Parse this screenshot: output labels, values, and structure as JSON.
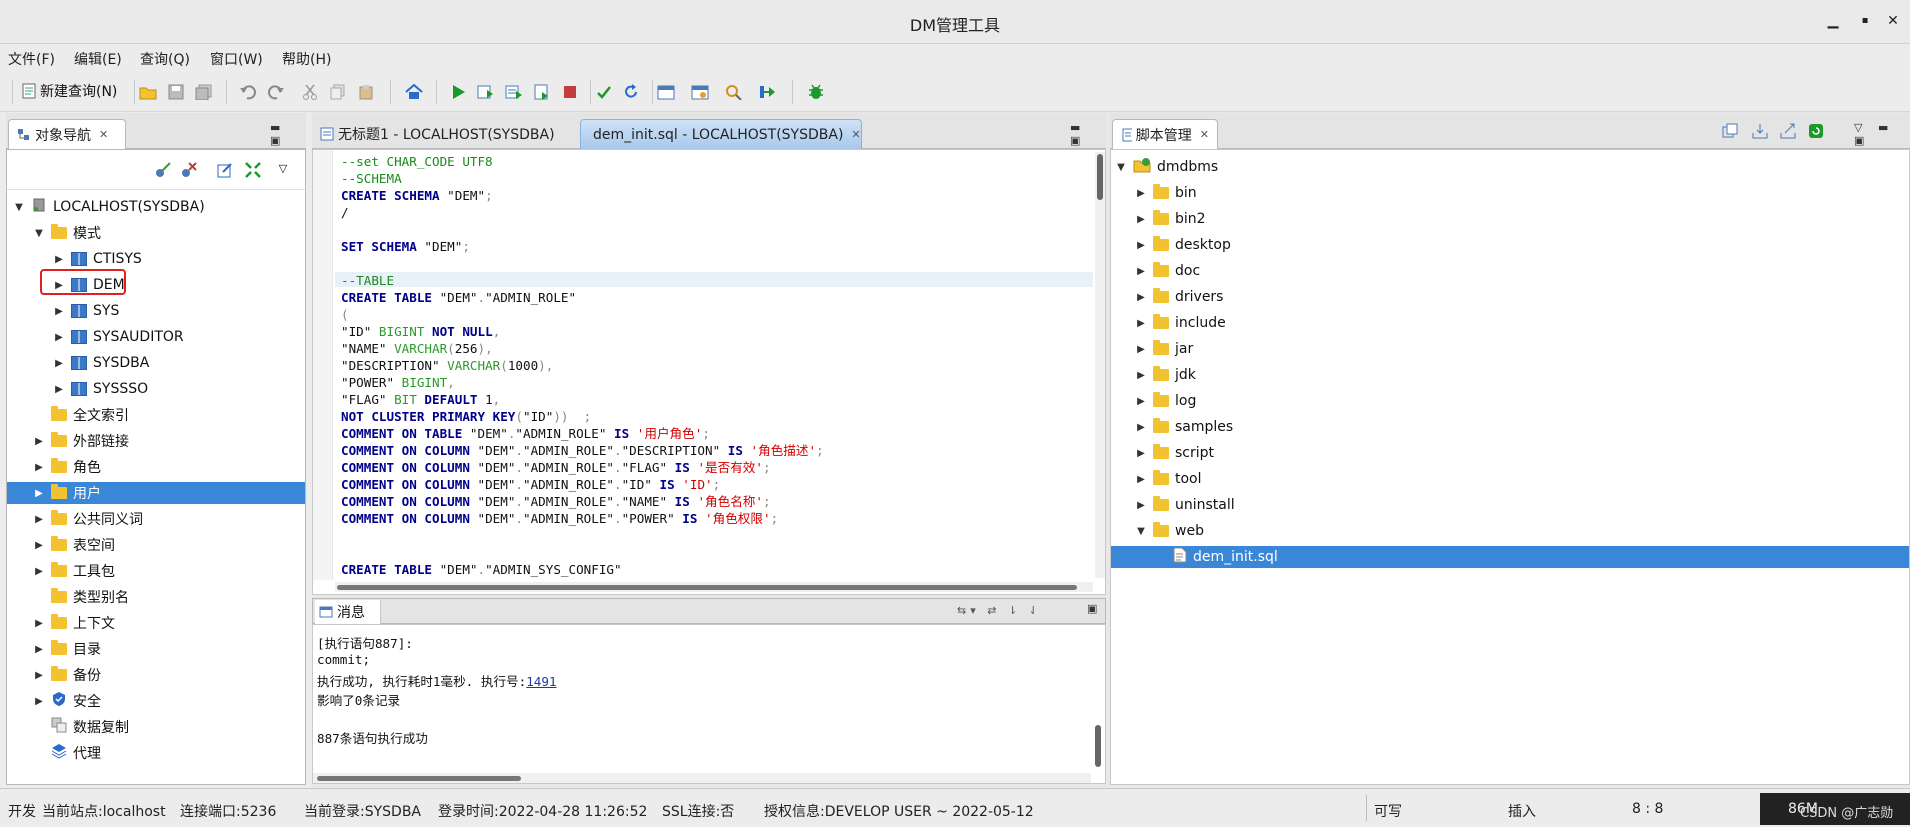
{
  "window": {
    "title": "DM管理工具",
    "minimize": "▪",
    "maximize": "▪",
    "close": "✕"
  },
  "menu": [
    "文件(F)",
    "编辑(E)",
    "查询(Q)",
    "窗口(W)",
    "帮助(H)"
  ],
  "toolbar": {
    "new_query_label": "新建查询(N)"
  },
  "nav": {
    "tab_label": "对象导航",
    "tree": [
      {
        "label": "LOCALHOST(SYSDBA)",
        "level": 0,
        "expanded": true,
        "icon": "server-icon"
      },
      {
        "label": "模式",
        "level": 1,
        "expanded": true,
        "icon": "folder-open-icon"
      },
      {
        "label": "CTISYS",
        "level": 2,
        "expanded": false,
        "icon": "schema-icon"
      },
      {
        "label": "DEM",
        "level": 2,
        "expanded": false,
        "icon": "schema-icon",
        "highlighted": true
      },
      {
        "label": "SYS",
        "level": 2,
        "expanded": false,
        "icon": "schema-icon"
      },
      {
        "label": "SYSAUDITOR",
        "level": 2,
        "expanded": false,
        "icon": "schema-icon"
      },
      {
        "label": "SYSDBA",
        "level": 2,
        "expanded": false,
        "icon": "schema-icon"
      },
      {
        "label": "SYSSSO",
        "level": 2,
        "expanded": false,
        "icon": "schema-icon"
      },
      {
        "label": "全文索引",
        "level": 1,
        "leaf": true,
        "icon": "folder-icon"
      },
      {
        "label": "外部链接",
        "level": 1,
        "expanded": false,
        "icon": "folder-icon"
      },
      {
        "label": "角色",
        "level": 1,
        "expanded": false,
        "icon": "folder-icon"
      },
      {
        "label": "用户",
        "level": 1,
        "expanded": false,
        "icon": "folder-icon",
        "selected": true
      },
      {
        "label": "公共同义词",
        "level": 1,
        "expanded": false,
        "icon": "folder-icon"
      },
      {
        "label": "表空间",
        "level": 1,
        "expanded": false,
        "icon": "folder-icon"
      },
      {
        "label": "工具包",
        "level": 1,
        "expanded": false,
        "icon": "folder-icon"
      },
      {
        "label": "类型别名",
        "level": 1,
        "leaf": true,
        "icon": "folder-icon"
      },
      {
        "label": "上下文",
        "level": 1,
        "expanded": false,
        "icon": "folder-icon"
      },
      {
        "label": "目录",
        "level": 1,
        "expanded": false,
        "icon": "folder-icon"
      },
      {
        "label": "备份",
        "level": 1,
        "expanded": false,
        "icon": "folder-icon"
      },
      {
        "label": "安全",
        "level": 1,
        "expanded": false,
        "icon": "shield-icon"
      },
      {
        "label": "数据复制",
        "level": 1,
        "leaf": true,
        "icon": "replication-icon"
      },
      {
        "label": "代理",
        "level": 1,
        "leaf": true,
        "icon": "agent-icon"
      }
    ]
  },
  "editor": {
    "tabs": [
      {
        "label": "无标题1 - LOCALHOST(SYSDBA)",
        "active": false
      },
      {
        "label": "dem_init.sql - LOCALHOST(SYSDBA)",
        "active": true
      }
    ]
  },
  "messages": {
    "tab_label": "消息",
    "lines": [
      "[执行语句887]:",
      "commit;",
      "执行成功, 执行耗时1毫秒. 执行号:",
      "影响了0条记录",
      "",
      "887条语句执行成功"
    ],
    "exec_number": "1491"
  },
  "scripts": {
    "tab_label": "脚本管理",
    "root": "dmdbms",
    "folders": [
      "bin",
      "bin2",
      "desktop",
      "doc",
      "drivers",
      "include",
      "jar",
      "jdk",
      "log",
      "samples",
      "script",
      "tool",
      "uninstall",
      "web"
    ],
    "expanded_folder": "web",
    "selected_file": "dem_init.sql"
  },
  "status": {
    "mode": "开发",
    "site": "当前站点:localhost",
    "port": "连接端口:5236",
    "login": "当前登录:SYSDBA",
    "login_time": "登录时间:2022-04-28 11:26:52",
    "ssl": "SSL连接:否",
    "license": "授权信息:DEVELOP USER ~ 2022-05-12",
    "writable": "可写",
    "insert": "插入",
    "cursor": "8 : 8",
    "memory": "86M",
    "watermark": "CSDN @广志勋"
  },
  "colors": {
    "selection": "#3a87d8",
    "keyword": "#00008b",
    "comment": "#1a8a1a",
    "string": "#d40000",
    "highlight_box": "#e02020"
  }
}
